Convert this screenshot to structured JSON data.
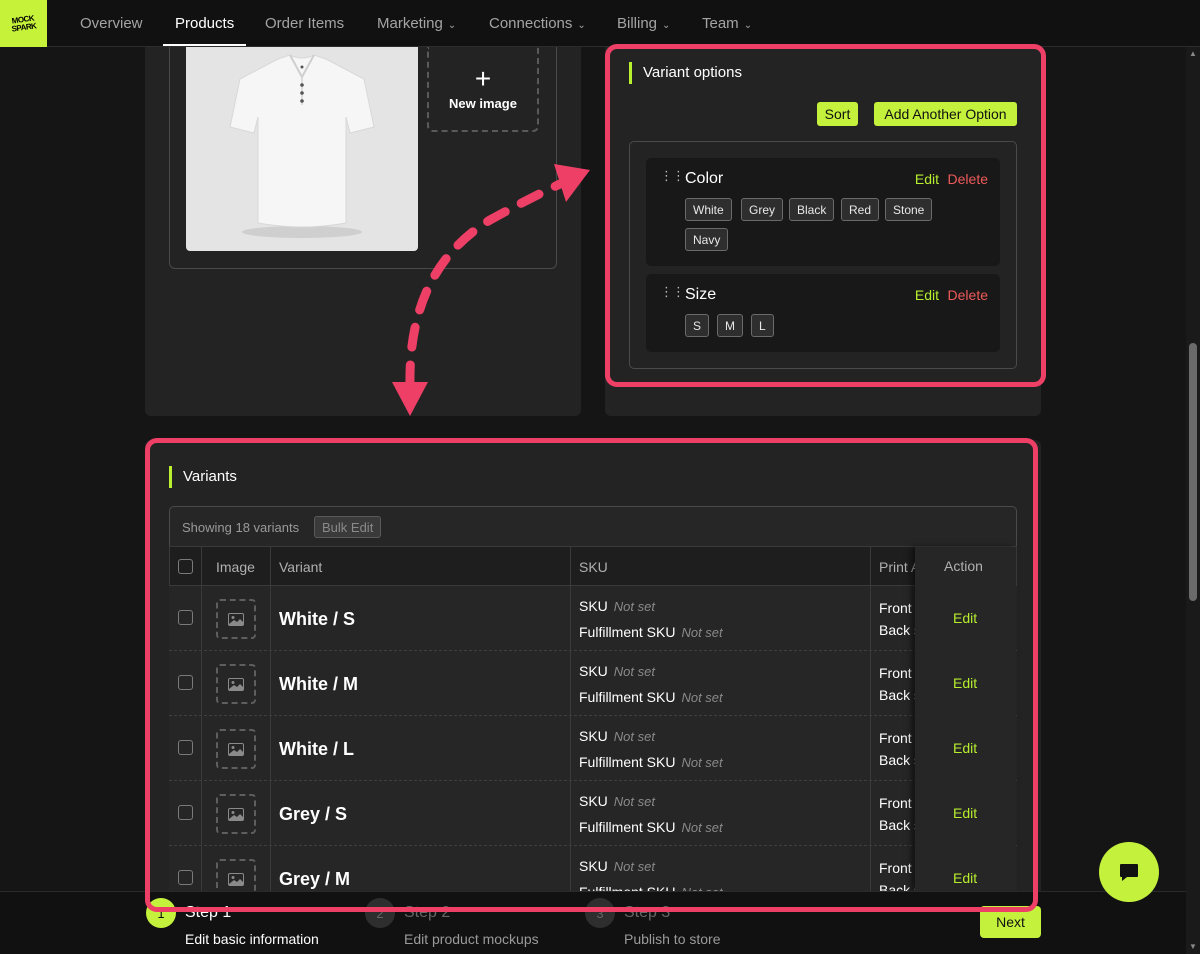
{
  "brand": {
    "logo_text": "MOCK SPARK",
    "accent": "#c4f23c",
    "highlight": "#ee3f66"
  },
  "nav": {
    "items": [
      {
        "label": "Overview",
        "dropdown": false,
        "active": false
      },
      {
        "label": "Products",
        "dropdown": false,
        "active": true
      },
      {
        "label": "Order Items",
        "dropdown": false,
        "active": false
      },
      {
        "label": "Marketing",
        "dropdown": true,
        "active": false
      },
      {
        "label": "Connections",
        "dropdown": true,
        "active": false
      },
      {
        "label": "Billing",
        "dropdown": true,
        "active": false
      },
      {
        "label": "Team",
        "dropdown": true,
        "active": false
      }
    ]
  },
  "images": {
    "new_image_label": "New image",
    "new_image_icon": "plus-icon"
  },
  "variant_options": {
    "title": "Variant options",
    "sort_label": "Sort",
    "add_label": "Add Another Option",
    "options": [
      {
        "name": "Color",
        "edit_label": "Edit",
        "delete_label": "Delete",
        "values": [
          "White",
          "Grey",
          "Black",
          "Red",
          "Stone",
          "Navy"
        ]
      },
      {
        "name": "Size",
        "edit_label": "Edit",
        "delete_label": "Delete",
        "values": [
          "S",
          "M",
          "L"
        ]
      }
    ]
  },
  "variants": {
    "title": "Variants",
    "showing_text": "Showing 18 variants",
    "bulk_edit_label": "Bulk Edit",
    "columns": {
      "image": "Image",
      "variant": "Variant",
      "sku": "SKU",
      "print_area": "Print A",
      "action": "Action"
    },
    "rows": [
      {
        "name": "White / S",
        "sku_label": "SKU",
        "sku_value": "Not set",
        "fsku_label": "Fulfillment SKU",
        "fsku_value": "Not set",
        "print1": "Front",
        "print2": "Back s",
        "action": "Edit"
      },
      {
        "name": "White / M",
        "sku_label": "SKU",
        "sku_value": "Not set",
        "fsku_label": "Fulfillment SKU",
        "fsku_value": "Not set",
        "print1": "Front",
        "print2": "Back s",
        "action": "Edit"
      },
      {
        "name": "White / L",
        "sku_label": "SKU",
        "sku_value": "Not set",
        "fsku_label": "Fulfillment SKU",
        "fsku_value": "Not set",
        "print1": "Front",
        "print2": "Back s",
        "action": "Edit"
      },
      {
        "name": "Grey / S",
        "sku_label": "SKU",
        "sku_value": "Not set",
        "fsku_label": "Fulfillment SKU",
        "fsku_value": "Not set",
        "print1": "Front",
        "print2": "Back s",
        "action": "Edit"
      },
      {
        "name": "Grey / M",
        "sku_label": "SKU",
        "sku_value": "Not set",
        "fsku_label": "Fulfillment SKU",
        "fsku_value": "Not set",
        "print1": "Front",
        "print2": "Back s",
        "action": "Edit"
      }
    ]
  },
  "steps": [
    {
      "number": "1",
      "title": "Step 1",
      "subtitle": "Edit basic information",
      "done": true
    },
    {
      "number": "2",
      "title": "Step 2",
      "subtitle": "Edit product mockups",
      "done": false
    },
    {
      "number": "3",
      "title": "Step 3",
      "subtitle": "Publish to store",
      "done": false
    }
  ],
  "next_label": "Next",
  "chat_icon": "chat-bubble-icon"
}
